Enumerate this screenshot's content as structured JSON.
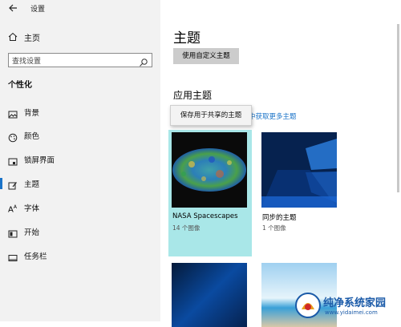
{
  "window": {
    "title": "设置",
    "back_icon": "back-arrow-icon"
  },
  "sidebar": {
    "home_label": "主页",
    "search": {
      "placeholder": "查找设置"
    },
    "section": "个性化",
    "items": [
      {
        "label": "背景",
        "icon": "image-icon"
      },
      {
        "label": "颜色",
        "icon": "palette-icon"
      },
      {
        "label": "锁屏界面",
        "icon": "lockscreen-icon"
      },
      {
        "label": "主题",
        "icon": "brush-icon",
        "active": true
      },
      {
        "label": "字体",
        "icon": "font-icon"
      },
      {
        "label": "开始",
        "icon": "start-icon"
      },
      {
        "label": "任务栏",
        "icon": "taskbar-icon"
      }
    ]
  },
  "main": {
    "title": "主题",
    "custom_theme_button": "使用自定义主题",
    "apply_heading": "应用主题",
    "get_more_link": "中获取更多主题",
    "tooltip": "保存用于共享的主题",
    "themes": [
      {
        "name": "NASA Spacescapes",
        "count": "14 个图像",
        "selected": true
      },
      {
        "name": "同步的主题",
        "count": "1 个图像"
      }
    ]
  },
  "watermark": {
    "name": "纯净系统家园",
    "url": "www.yidaimei.com"
  },
  "colors": {
    "accent": "#1a73c8",
    "selected_tile": "#a9e7e8",
    "sidebar_bg": "#f2f2f2"
  }
}
